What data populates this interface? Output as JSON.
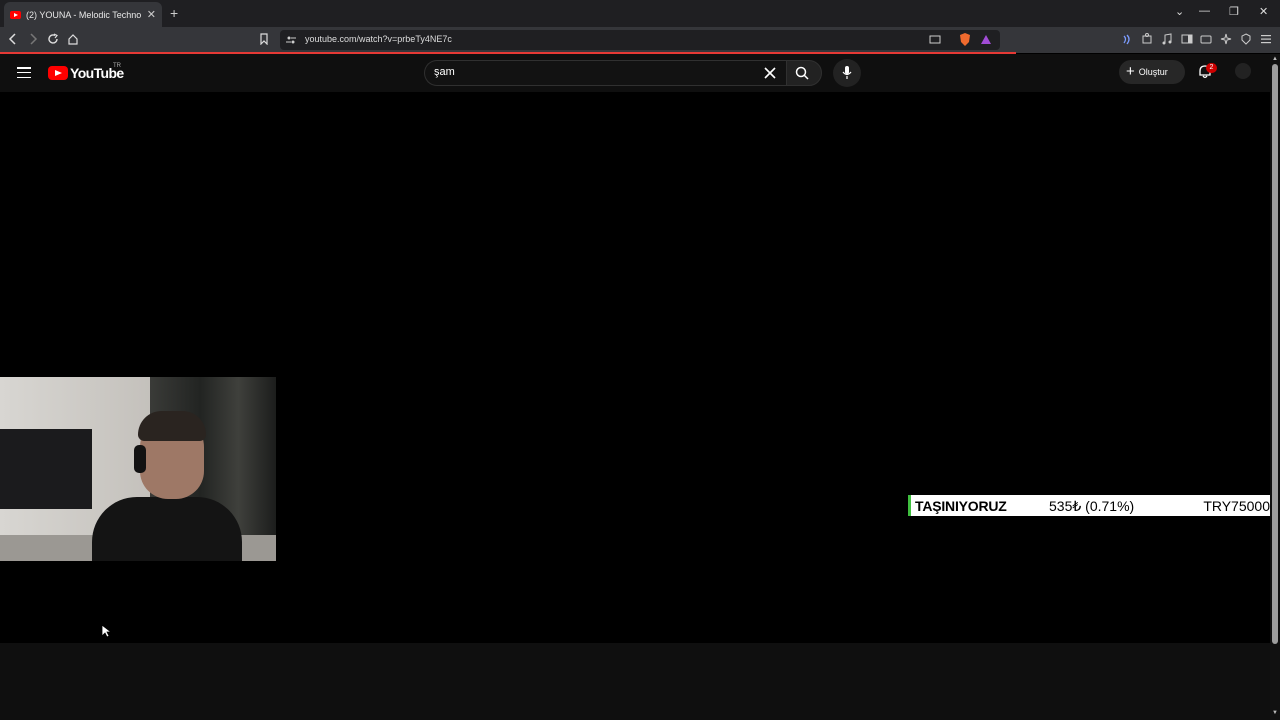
{
  "browser": {
    "tab_title": "(2) YOUNA - Melodic Techno &",
    "tab_close": "✕",
    "new_tab": "+",
    "url": "youtube.com/watch?v=prbeTy4NE7c",
    "window_controls": [
      "⌄",
      "—",
      "❐",
      "✕"
    ]
  },
  "youtube": {
    "logo_text": "YouTube",
    "region": "TR",
    "search_value": "şam",
    "create_label": "Oluştur",
    "notification_count": "2"
  },
  "overlay": {
    "ticker_label": "TAŞINIYORUZ",
    "ticker_value": "535₺ (0.71%)",
    "ticker_price": "TRY75000"
  },
  "icons": {
    "back": "back-icon",
    "forward": "forward-icon",
    "reload": "reload-icon",
    "home": "home-icon",
    "bookmark": "bookmark-icon",
    "menu": "menu-icon",
    "search": "search-icon",
    "mic": "mic-icon",
    "bell": "bell-icon",
    "clear": "close-icon"
  },
  "colors": {
    "youtube_red": "#ff0000",
    "ticker_accent": "#3fbf3f",
    "progress": "#e53935"
  }
}
